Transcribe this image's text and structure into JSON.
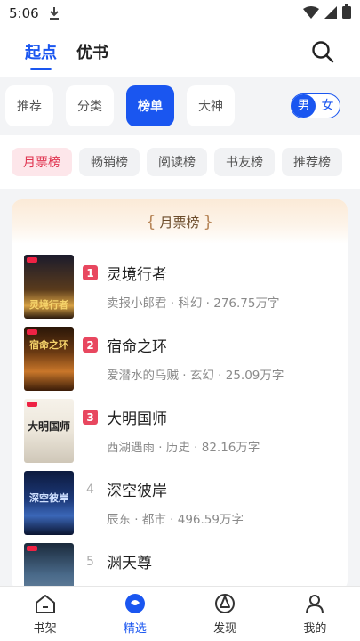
{
  "status": {
    "time": "5:06"
  },
  "header": {
    "tabs": [
      "起点",
      "优书"
    ]
  },
  "segments": {
    "items": [
      "推荐",
      "分类",
      "榜单",
      "大神"
    ],
    "gender": {
      "on": "男",
      "off": "女"
    }
  },
  "chips": [
    "月票榜",
    "畅销榜",
    "阅读榜",
    "书友榜",
    "推荐榜"
  ],
  "card": {
    "title": "月票榜",
    "books": [
      {
        "rank": "1",
        "title": "灵境行者",
        "author": "卖报小郎君",
        "genre": "科幻",
        "words": "276.75万字",
        "cover_text": "灵境行者"
      },
      {
        "rank": "2",
        "title": "宿命之环",
        "author": "爱潜水的乌贼",
        "genre": "玄幻",
        "words": "25.09万字",
        "cover_text": "宿命之环"
      },
      {
        "rank": "3",
        "title": "大明国师",
        "author": "西湖遇雨",
        "genre": "历史",
        "words": "82.16万字",
        "cover_text": "大明国师"
      },
      {
        "rank": "4",
        "title": "深空彼岸",
        "author": "辰东",
        "genre": "都市",
        "words": "496.59万字",
        "cover_text": "深空彼岸"
      },
      {
        "rank": "5",
        "title": "渊天尊",
        "author": "",
        "genre": "",
        "words": "",
        "cover_text": ""
      }
    ]
  },
  "bottomnav": [
    "书架",
    "精选",
    "发现",
    "我的"
  ],
  "colors": {
    "accent": "#1a56f0",
    "rank_red": "#e8475f"
  }
}
